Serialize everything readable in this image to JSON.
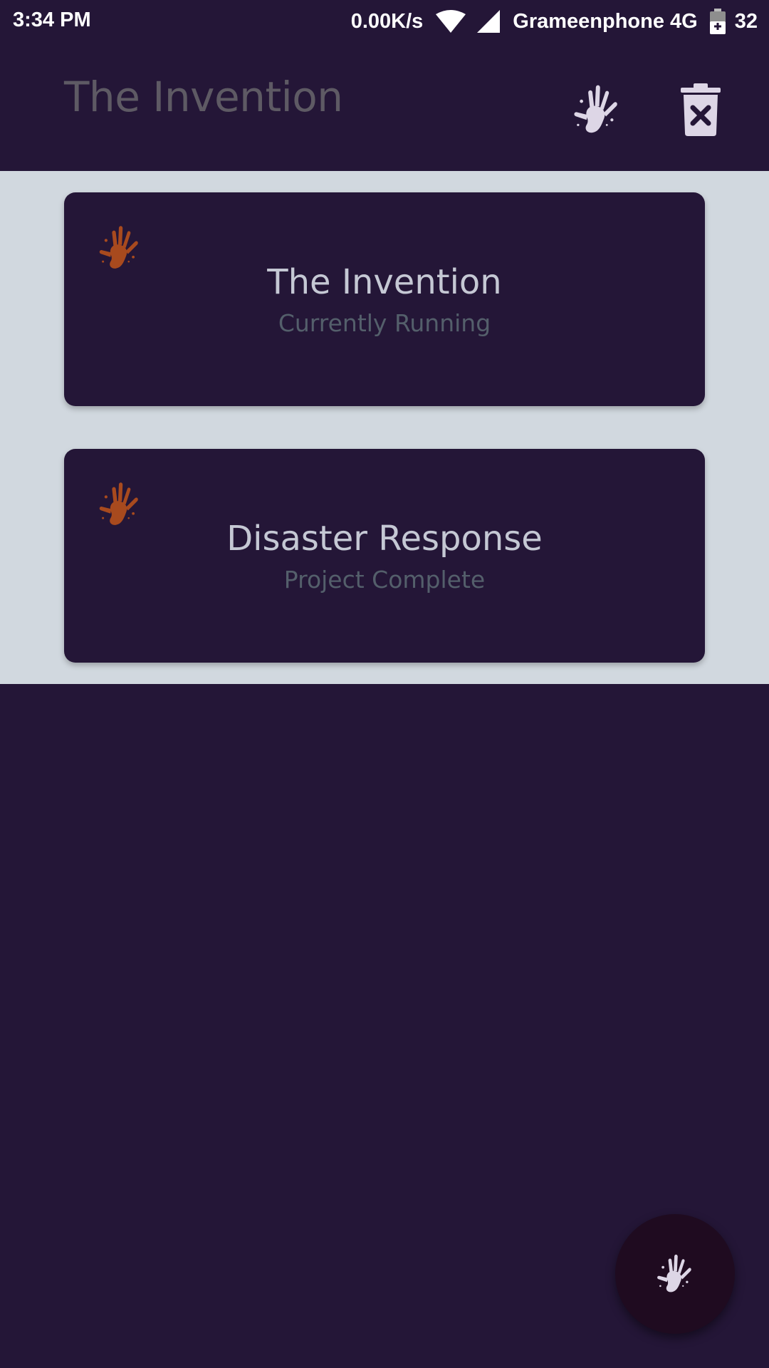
{
  "status_bar": {
    "time": "3:34 PM",
    "net_speed": "0.00K/s",
    "carrier": "Grameenphone 4G",
    "battery": "32",
    "icons": [
      "wifi-icon",
      "signal-icon",
      "battery-icon"
    ]
  },
  "app_bar": {
    "title": "The Invention",
    "actions": [
      "hand-icon",
      "delete-icon"
    ]
  },
  "projects": [
    {
      "title": "The Invention",
      "status": "Currently Running",
      "icon": "hand-icon"
    },
    {
      "title": "Disaster Response",
      "status": "Project Complete",
      "icon": "hand-icon"
    }
  ],
  "fab": {
    "icon": "hand-icon"
  },
  "colors": {
    "background": "#241637",
    "list_background": "#d1d8df",
    "card_hand": "#a84a1e",
    "light_hand": "#ddd6e6",
    "fab": "#1f0b20"
  }
}
